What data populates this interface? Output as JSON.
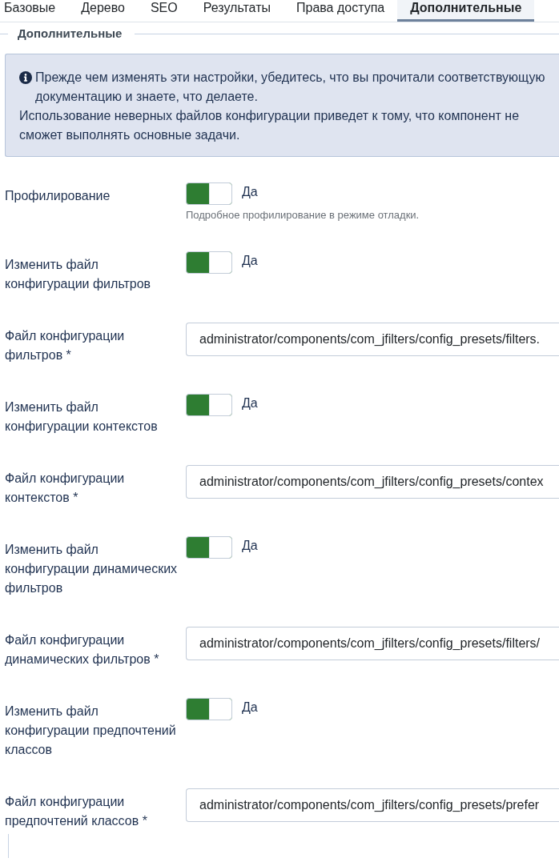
{
  "tabs": [
    {
      "label": "Базовые",
      "selected": false
    },
    {
      "label": "Дерево",
      "selected": false
    },
    {
      "label": "SEO",
      "selected": false
    },
    {
      "label": "Результаты",
      "selected": false
    },
    {
      "label": "Права доступа",
      "selected": false
    },
    {
      "label": "Дополнительные",
      "selected": true
    }
  ],
  "fieldset": {
    "legend": "Дополнительные"
  },
  "alert": {
    "paragraphs": [
      "Прежде чем изменять эти настройки, убедитесь, что вы прочитали соответствующую документацию и знаете, что делаете.",
      "Использование неверных файлов конфигурации приведет к тому, что компонент не сможет выполнять основные задачи."
    ]
  },
  "fields": [
    {
      "kind": "toggle",
      "label": "Профилирование",
      "on": true,
      "state_label": "Да",
      "help": "Подробное профилирование в режиме отладки."
    },
    {
      "kind": "toggle",
      "label": "Изменить файл конфигурации фильтров",
      "on": true,
      "state_label": "Да"
    },
    {
      "kind": "text",
      "label": "Файл конфигурации фильтров *",
      "value": "administrator/components/com_jfilters/config_presets/filters."
    },
    {
      "kind": "toggle",
      "label": "Изменить файл конфигурации контекстов",
      "on": true,
      "state_label": "Да"
    },
    {
      "kind": "text",
      "label": "Файл конфигурации контекстов *",
      "value": "administrator/components/com_jfilters/config_presets/contex"
    },
    {
      "kind": "toggle",
      "label": "Изменить файл конфигурации динамических фильтров",
      "on": true,
      "state_label": "Да"
    },
    {
      "kind": "text",
      "label": "Файл конфигурации динамических фильтров *",
      "value": "administrator/components/com_jfilters/config_presets/filters/"
    },
    {
      "kind": "toggle",
      "label": "Изменить файл конфигурации предпочтений классов",
      "on": true,
      "state_label": "Да"
    },
    {
      "kind": "text",
      "label": "Файл конфигурации предпочтений классов *",
      "value": "administrator/components/com_jfilters/config_presets/prefer"
    }
  ]
}
